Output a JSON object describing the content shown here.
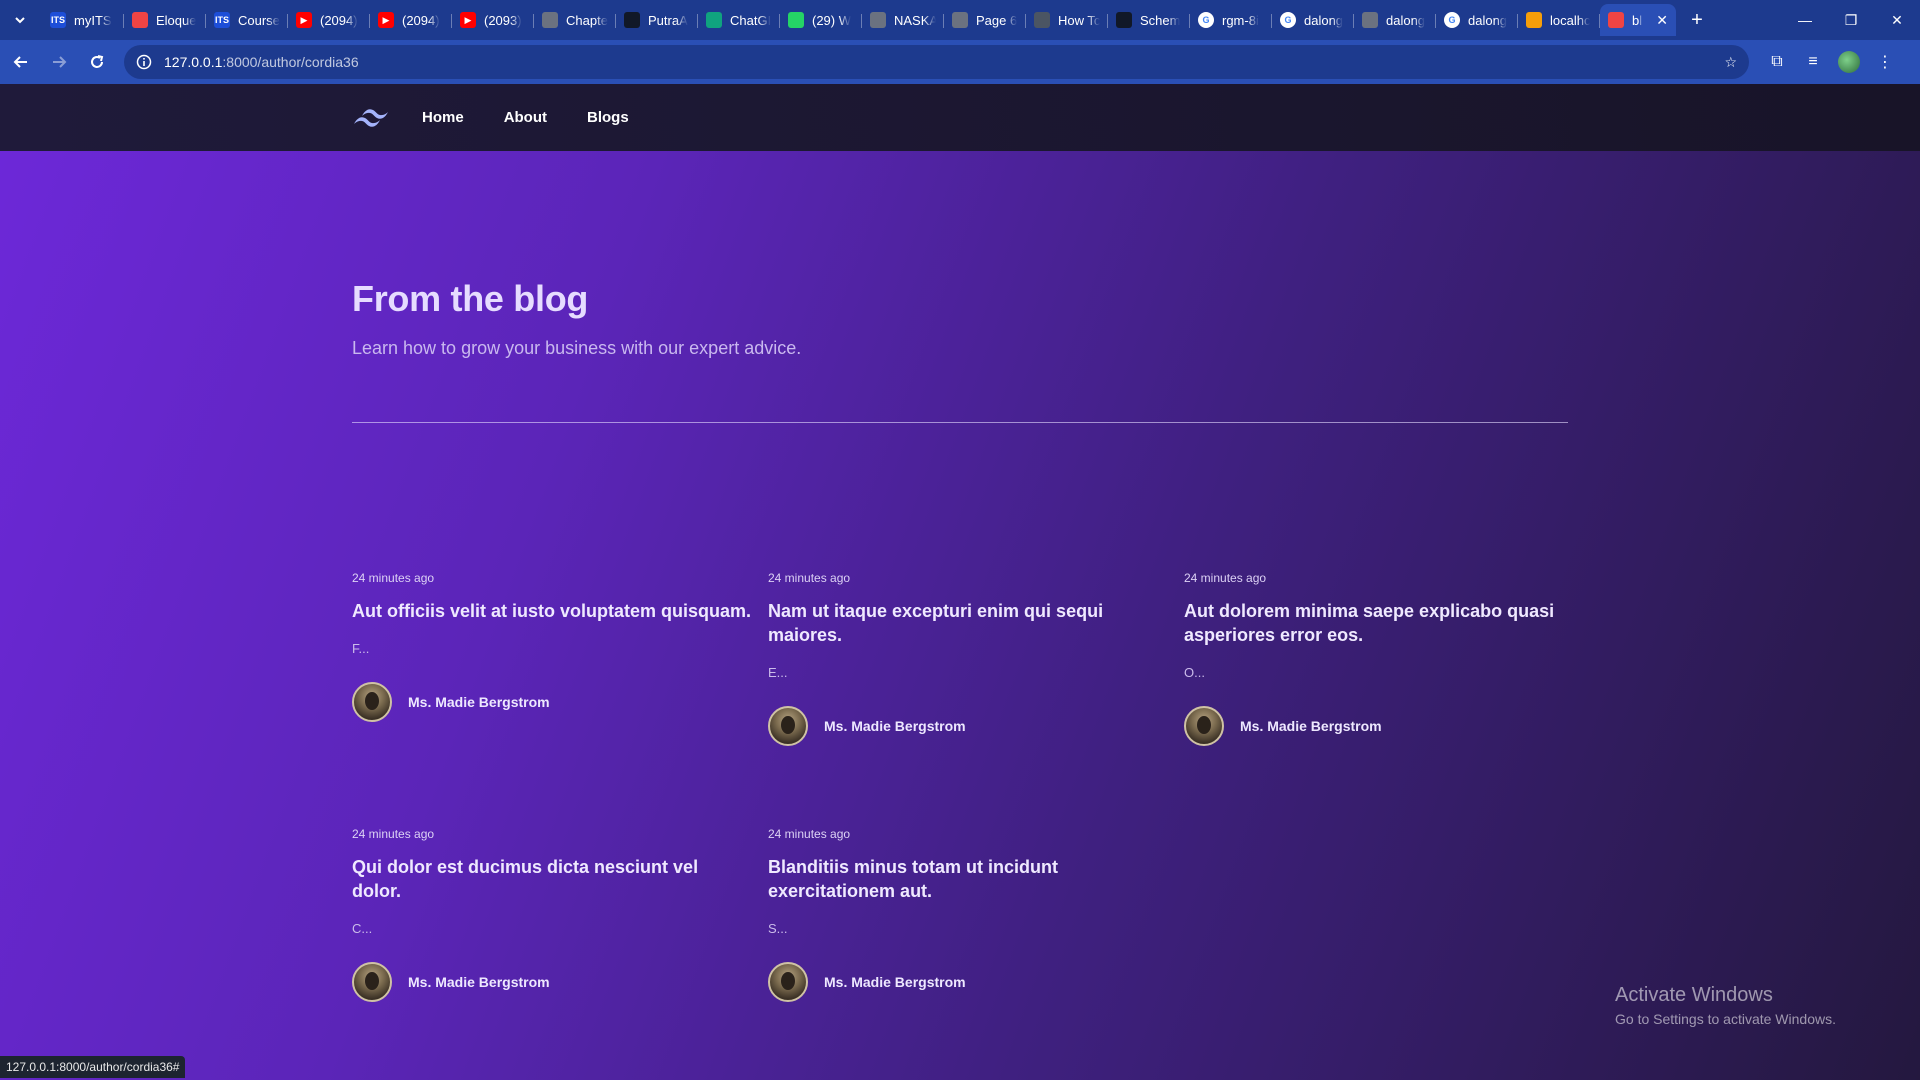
{
  "browser": {
    "tabs": [
      {
        "label": "myITS",
        "fav_text": "ITS",
        "fav_color": "#1d4ed8"
      },
      {
        "label": "Eloque",
        "fav_text": "",
        "fav_color": "#ef4444"
      },
      {
        "label": "Course",
        "fav_text": "ITS",
        "fav_color": "#1d4ed8"
      },
      {
        "label": "(2094)",
        "fav_text": "▶",
        "fav_color": "#ff0000"
      },
      {
        "label": "(2094)",
        "fav_text": "▶",
        "fav_color": "#ff0000"
      },
      {
        "label": "(2093)",
        "fav_text": "▶",
        "fav_color": "#ff0000"
      },
      {
        "label": "Chapte",
        "fav_text": "",
        "fav_color": "#6b7280"
      },
      {
        "label": "PutraA",
        "fav_text": "",
        "fav_color": "#111827"
      },
      {
        "label": "ChatGI",
        "fav_text": "",
        "fav_color": "#10a37f"
      },
      {
        "label": "(29) W",
        "fav_text": "",
        "fav_color": "#25d366"
      },
      {
        "label": "NASKA",
        "fav_text": "",
        "fav_color": "#6b7280"
      },
      {
        "label": "Page 6",
        "fav_text": "",
        "fav_color": "#6b7280"
      },
      {
        "label": "How Tc",
        "fav_text": "",
        "fav_color": "#4b5563"
      },
      {
        "label": "Schem",
        "fav_text": "",
        "fav_color": "#111827"
      },
      {
        "label": "rgm-8i",
        "fav_text": "G",
        "fav_color": "#ffffff"
      },
      {
        "label": "dalong",
        "fav_text": "G",
        "fav_color": "#ffffff"
      },
      {
        "label": "dalong",
        "fav_text": "",
        "fav_color": "#6b7280"
      },
      {
        "label": "dalong",
        "fav_text": "G",
        "fav_color": "#ffffff"
      },
      {
        "label": "localhc",
        "fav_text": "",
        "fav_color": "#f59e0b"
      }
    ],
    "active_tab": {
      "label": "bl",
      "fav_color": "#ef4444"
    },
    "url_host": "127.0.0.1",
    "url_path": ":8000/author/cordia36",
    "status_url": "127.0.0.1:8000/author/cordia36#"
  },
  "nav": {
    "links": [
      "Home",
      "About",
      "Blogs"
    ]
  },
  "blog": {
    "title": "From the blog",
    "subtitle": "Learn how to grow your business with our expert advice.",
    "posts": [
      {
        "time": "24 minutes ago",
        "title": "Aut officiis velit at iusto voluptatem quisquam.",
        "excerpt": "F...",
        "author": "Ms. Madie Bergstrom"
      },
      {
        "time": "24 minutes ago",
        "title": "Nam ut itaque excepturi enim qui sequi maiores.",
        "excerpt": "E...",
        "author": "Ms. Madie Bergstrom"
      },
      {
        "time": "24 minutes ago",
        "title": "Aut dolorem minima saepe explicabo quasi asperiores error eos.",
        "excerpt": "O...",
        "author": "Ms. Madie Bergstrom"
      },
      {
        "time": "24 minutes ago",
        "title": "Qui dolor est ducimus dicta nesciunt vel dolor.",
        "excerpt": "C...",
        "author": "Ms. Madie Bergstrom"
      },
      {
        "time": "24 minutes ago",
        "title": "Blanditiis minus totam ut incidunt exercitationem aut.",
        "excerpt": "S...",
        "author": "Ms. Madie Bergstrom"
      }
    ]
  },
  "watermark": {
    "line1": "Activate Windows",
    "line2": "Go to Settings to activate Windows."
  }
}
